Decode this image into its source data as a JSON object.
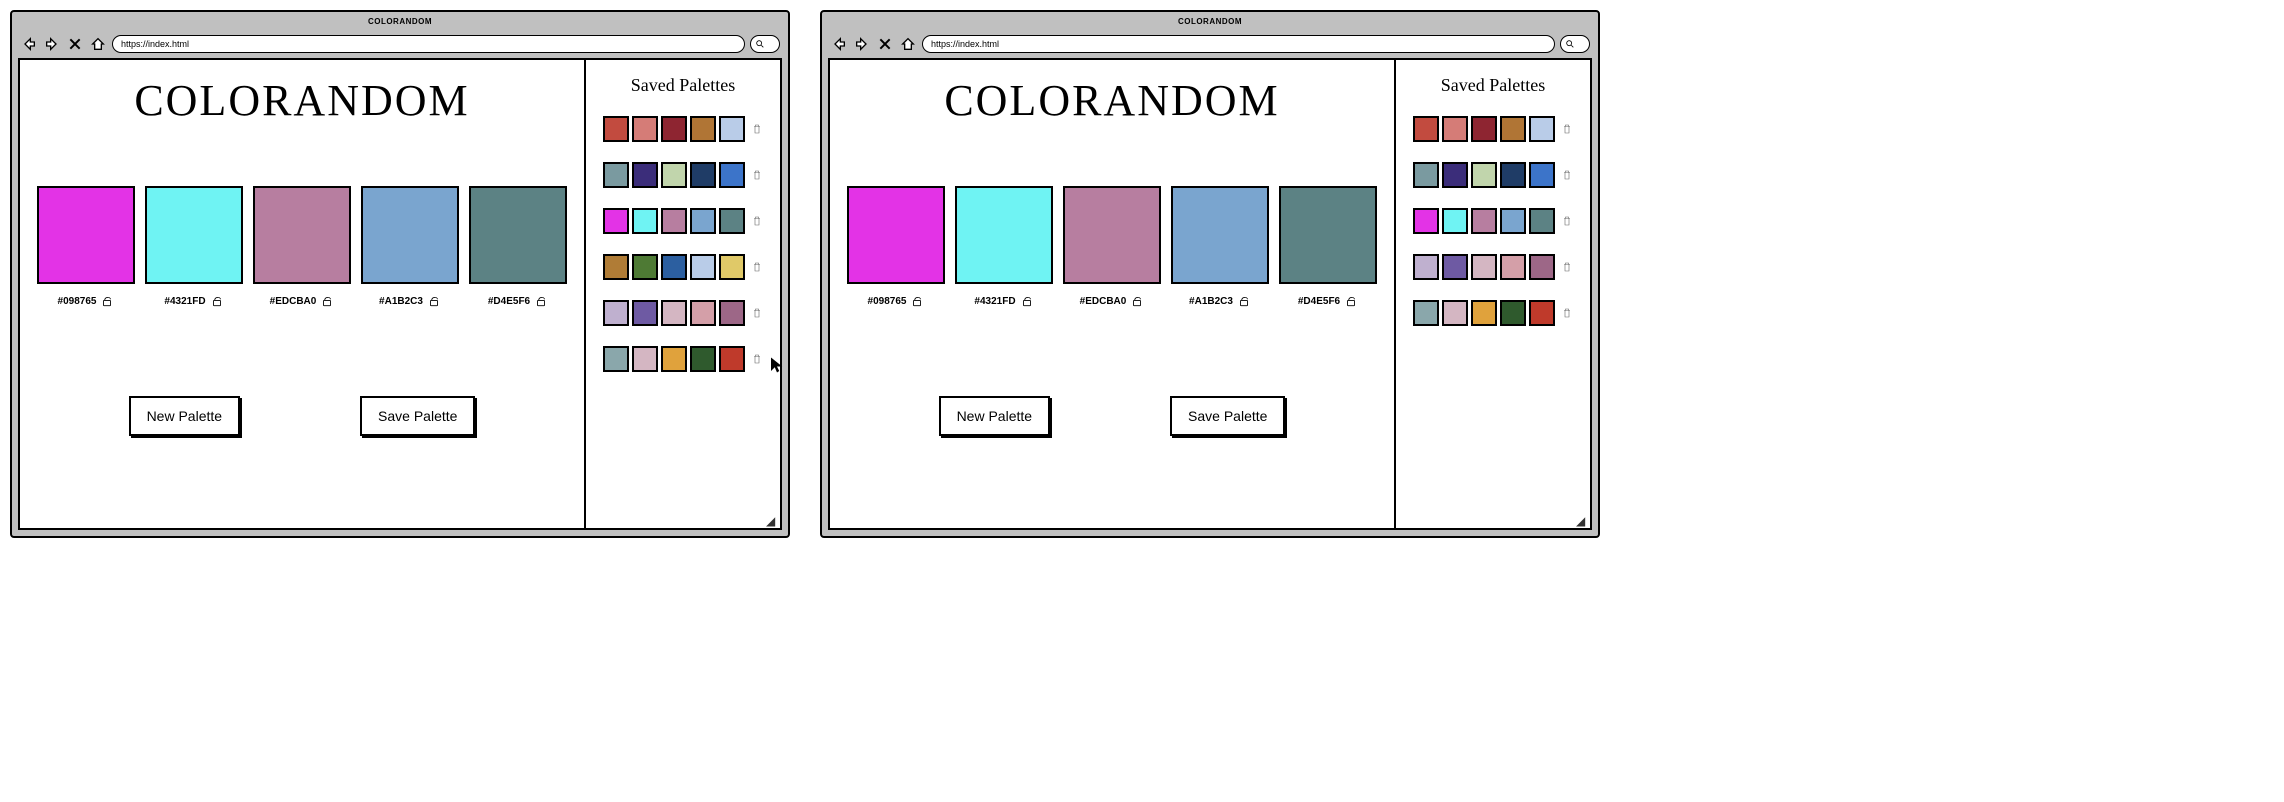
{
  "windows": [
    {
      "title": "COLORANDOM",
      "url": "https://index.html",
      "logo": "COLORANDOM",
      "swatches": [
        {
          "hex": "#098765",
          "color": "#e333e6",
          "locked": false
        },
        {
          "hex": "#4321FD",
          "color": "#6ff3f3",
          "locked": false
        },
        {
          "hex": "#EDCBA0",
          "color": "#b77ea0",
          "locked": false
        },
        {
          "hex": "#A1B2C3",
          "color": "#7aa5cf",
          "locked": false
        },
        {
          "hex": "#D4E5F6",
          "color": "#5c8284",
          "locked": false
        }
      ],
      "buttons": {
        "new": "New Palette",
        "save": "Save Palette"
      },
      "sidebar_title": "Saved Palettes",
      "saved_palettes": [
        [
          "#c24b3f",
          "#d57c77",
          "#8e2531",
          "#b07535",
          "#b9cce8"
        ],
        [
          "#7a9aa0",
          "#3b2d7a",
          "#c1d5ac",
          "#1f3c66",
          "#3c74c9"
        ],
        [
          "#e333e6",
          "#6ff3f3",
          "#b77ea0",
          "#7aa5cf",
          "#5c8284"
        ],
        [
          "#b07c36",
          "#4e7a34",
          "#2c5fa0",
          "#b9cce8",
          "#e0c968"
        ],
        [
          "#bfb0cf",
          "#6e5aa3",
          "#d4b6c2",
          "#d49fa8",
          "#9d6787"
        ],
        [
          "#8aa7ab",
          "#d4b6c2",
          "#e0a23c",
          "#2f5a2d",
          "#bf3a2b"
        ]
      ],
      "show_cursor": true
    },
    {
      "title": "COLORANDOM",
      "url": "https://index.html",
      "logo": "COLORANDOM",
      "swatches": [
        {
          "hex": "#098765",
          "color": "#e333e6",
          "locked": false
        },
        {
          "hex": "#4321FD",
          "color": "#6ff3f3",
          "locked": false
        },
        {
          "hex": "#EDCBA0",
          "color": "#b77ea0",
          "locked": false
        },
        {
          "hex": "#A1B2C3",
          "color": "#7aa5cf",
          "locked": false
        },
        {
          "hex": "#D4E5F6",
          "color": "#5c8284",
          "locked": false
        }
      ],
      "buttons": {
        "new": "New Palette",
        "save": "Save Palette"
      },
      "sidebar_title": "Saved Palettes",
      "saved_palettes": [
        [
          "#c24b3f",
          "#d57c77",
          "#8e2531",
          "#b07535",
          "#b9cce8"
        ],
        [
          "#7a9aa0",
          "#3b2d7a",
          "#c1d5ac",
          "#1f3c66",
          "#3c74c9"
        ],
        [
          "#e333e6",
          "#6ff3f3",
          "#b77ea0",
          "#7aa5cf",
          "#5c8284"
        ],
        [
          "#bfb0cf",
          "#6e5aa3",
          "#d4b6c2",
          "#d49fa8",
          "#9d6787"
        ],
        [
          "#8aa7ab",
          "#d4b6c2",
          "#e0a23c",
          "#2f5a2d",
          "#bf3a2b"
        ]
      ],
      "show_cursor": false
    }
  ]
}
